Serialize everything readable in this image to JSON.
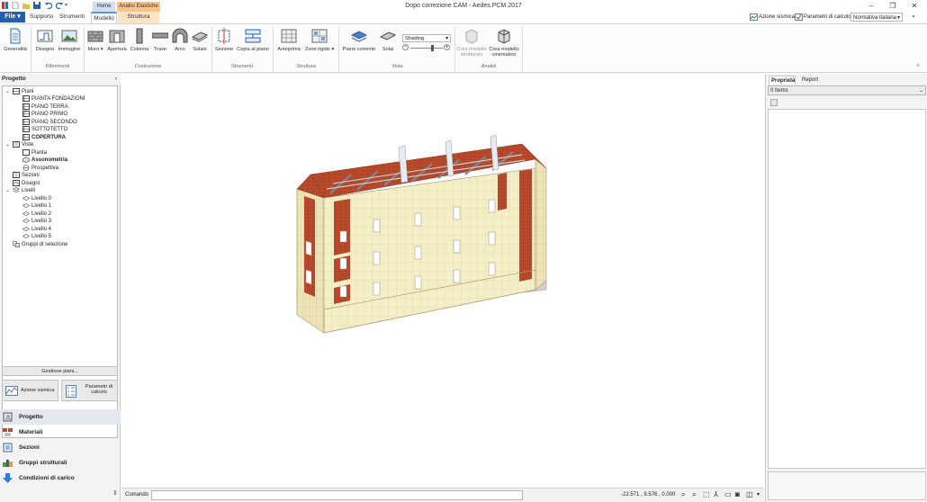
{
  "window": {
    "title": "Dopo correzione CAM - Aedes.PCM 2017"
  },
  "ribbon_tabs": [
    {
      "label": "File"
    },
    {
      "label": "Supporto"
    },
    {
      "label": "Strumenti"
    },
    {
      "label": "Modello"
    },
    {
      "label": "Struttura"
    }
  ],
  "context_tabs": {
    "home": "Home",
    "analisi": "Analisi Elastiche"
  },
  "header_right": {
    "azione_sismica": "Azione sismica",
    "parametri_calcolo": "Parametri di calcolo",
    "normativa": "Normativa italiana"
  },
  "ribbon": {
    "generalita": "Generalità",
    "disegno": "Disegno",
    "immagine": "Immagine",
    "muro": "Muro",
    "apertura": "Apertura",
    "colonna": "Colonna",
    "trave": "Trave",
    "arco": "Arco",
    "solaio": "Solaio",
    "sezione": "Sezione",
    "copia_piano": "Copia al piano",
    "anteprima": "Anteprima",
    "zone_rigide": "Zone rigide",
    "piano_corrente": "Piano corrente",
    "solai": "Solai",
    "shading": "Shading",
    "crea_strutturale_1": "Crea modello",
    "crea_strutturale_2": "strutturale",
    "crea_cinematico_1": "Crea modello",
    "crea_cinematico_2": "cinematico",
    "groups": {
      "riferimenti": "Riferimenti",
      "costruzione": "Costruzione",
      "strumenti": "Strumenti",
      "struttura": "Struttura",
      "vista": "Vista",
      "analisi": "Analisi"
    }
  },
  "left_panel": {
    "header": "Progetto",
    "tree": {
      "piani": "Piani",
      "piani_items": [
        "PIANTA FONDAZIONI",
        "PIANO TERRA",
        "PIANO PRIMO",
        "PIANO SECONDO",
        "SOTTOTETTO",
        "COPERTURA"
      ],
      "viste": "Viste",
      "viste_items": [
        "Pianta",
        "Assonometria",
        "Prospettiva"
      ],
      "sezioni": "Sezioni",
      "disegni": "Disegni",
      "livelli": "Livelli",
      "livelli_items": [
        "Livello 0",
        "Livello 1",
        "Livello 2",
        "Livello 3",
        "Livello 4",
        "Livello 5"
      ],
      "gruppi": "Gruppi di selezione"
    },
    "gestione_piani": "Gestione piani...",
    "azione_sismica": "Azione sismica",
    "parametri_1": "Parametri di",
    "parametri_2": "calcolo",
    "nav": [
      "Progetto",
      "Materiali",
      "Sezioni",
      "Gruppi strutturali",
      "Condizioni di carico"
    ]
  },
  "right_panel": {
    "tabs": [
      "Proprietà",
      "Report"
    ],
    "items_count": "0 Items"
  },
  "status": {
    "comando_label": "Comando",
    "coords": "-22.571 , 9.576 , 0.000"
  },
  "colors": {
    "accent": "#1f5fae",
    "brick": "#b94a2c",
    "plaster": "#f6efc6",
    "context_orange": "#f7c48a"
  }
}
